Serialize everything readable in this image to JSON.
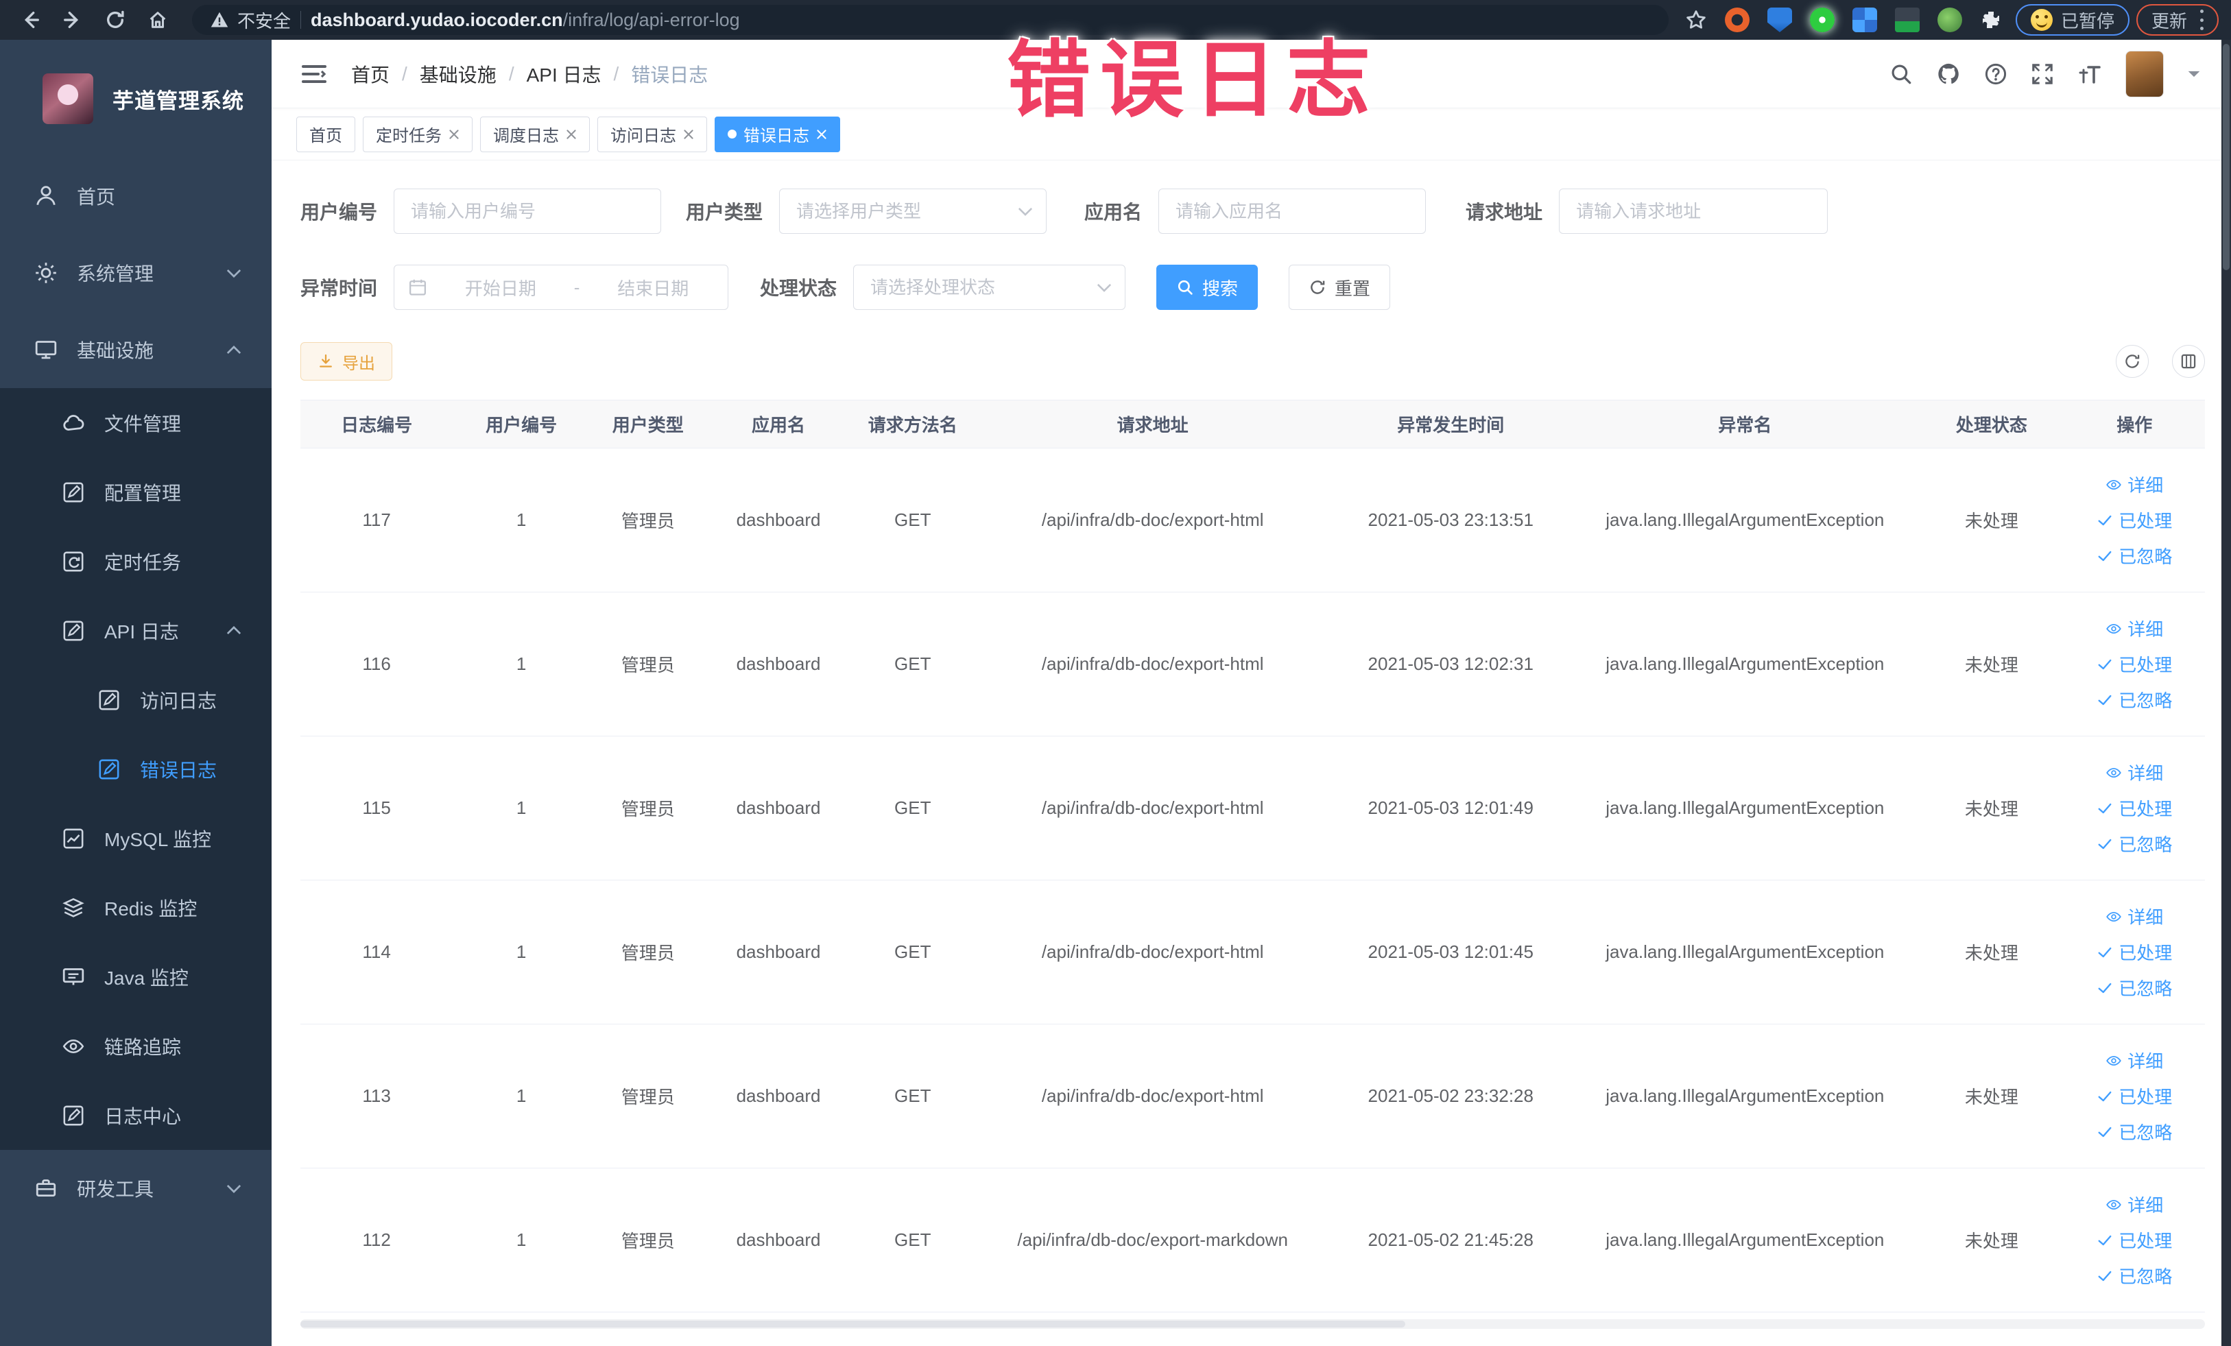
{
  "browser": {
    "security_label": "不安全",
    "url_host": "dashboard.yudao.iocoder.cn",
    "url_path": "/infra/log/api-error-log",
    "paused_label": "已暂停",
    "update_label": "更新"
  },
  "annotation": {
    "text": "错误日志",
    "color": "#ee3f63"
  },
  "sidebar": {
    "title": "芋道管理系统",
    "items": [
      {
        "label": "首页"
      },
      {
        "label": "系统管理"
      },
      {
        "label": "基础设施"
      },
      {
        "label": "文件管理"
      },
      {
        "label": "配置管理"
      },
      {
        "label": "定时任务"
      },
      {
        "label": "API 日志"
      },
      {
        "label": "访问日志"
      },
      {
        "label": "错误日志"
      },
      {
        "label": "MySQL 监控"
      },
      {
        "label": "Redis 监控"
      },
      {
        "label": "Java 监控"
      },
      {
        "label": "链路追踪"
      },
      {
        "label": "日志中心"
      },
      {
        "label": "研发工具"
      }
    ]
  },
  "breadcrumb": {
    "items": [
      "首页",
      "基础设施",
      "API 日志",
      "错误日志"
    ]
  },
  "tabs": [
    {
      "label": "首页"
    },
    {
      "label": "定时任务"
    },
    {
      "label": "调度日志"
    },
    {
      "label": "访问日志"
    },
    {
      "label": "错误日志"
    }
  ],
  "filters": {
    "user_id": {
      "label": "用户编号",
      "placeholder": "请输入用户编号"
    },
    "user_type": {
      "label": "用户类型",
      "placeholder": "请选择用户类型"
    },
    "app_name": {
      "label": "应用名",
      "placeholder": "请输入应用名"
    },
    "request_url": {
      "label": "请求地址",
      "placeholder": "请输入请求地址"
    },
    "exception_time": {
      "label": "异常时间",
      "start_placeholder": "开始日期",
      "separator": "-",
      "end_placeholder": "结束日期"
    },
    "process_status": {
      "label": "处理状态",
      "placeholder": "请选择处理状态"
    },
    "search_label": "搜索",
    "reset_label": "重置"
  },
  "toolbar": {
    "export_label": "导出"
  },
  "table": {
    "columns": [
      "日志编号",
      "用户编号",
      "用户类型",
      "应用名",
      "请求方法名",
      "请求地址",
      "异常发生时间",
      "异常名",
      "处理状态",
      "操作"
    ],
    "action_labels": {
      "detail": "详细",
      "processed": "已处理",
      "ignored": "已忽略"
    },
    "rows": [
      {
        "id": "117",
        "user_id": "1",
        "user_type": "管理员",
        "app": "dashboard",
        "method": "GET",
        "url": "/api/infra/db-doc/export-html",
        "time": "2021-05-03 23:13:51",
        "exception": "java.lang.IllegalArgumentException",
        "status": "未处理"
      },
      {
        "id": "116",
        "user_id": "1",
        "user_type": "管理员",
        "app": "dashboard",
        "method": "GET",
        "url": "/api/infra/db-doc/export-html",
        "time": "2021-05-03 12:02:31",
        "exception": "java.lang.IllegalArgumentException",
        "status": "未处理"
      },
      {
        "id": "115",
        "user_id": "1",
        "user_type": "管理员",
        "app": "dashboard",
        "method": "GET",
        "url": "/api/infra/db-doc/export-html",
        "time": "2021-05-03 12:01:49",
        "exception": "java.lang.IllegalArgumentException",
        "status": "未处理"
      },
      {
        "id": "114",
        "user_id": "1",
        "user_type": "管理员",
        "app": "dashboard",
        "method": "GET",
        "url": "/api/infra/db-doc/export-html",
        "time": "2021-05-03 12:01:45",
        "exception": "java.lang.IllegalArgumentException",
        "status": "未处理"
      },
      {
        "id": "113",
        "user_id": "1",
        "user_type": "管理员",
        "app": "dashboard",
        "method": "GET",
        "url": "/api/infra/db-doc/export-html",
        "time": "2021-05-02 23:32:28",
        "exception": "java.lang.IllegalArgumentException",
        "status": "未处理"
      },
      {
        "id": "112",
        "user_id": "1",
        "user_type": "管理员",
        "app": "dashboard",
        "method": "GET",
        "url": "/api/infra/db-doc/export-markdown",
        "time": "2021-05-02 21:45:28",
        "exception": "java.lang.IllegalArgumentException",
        "status": "未处理"
      }
    ]
  }
}
